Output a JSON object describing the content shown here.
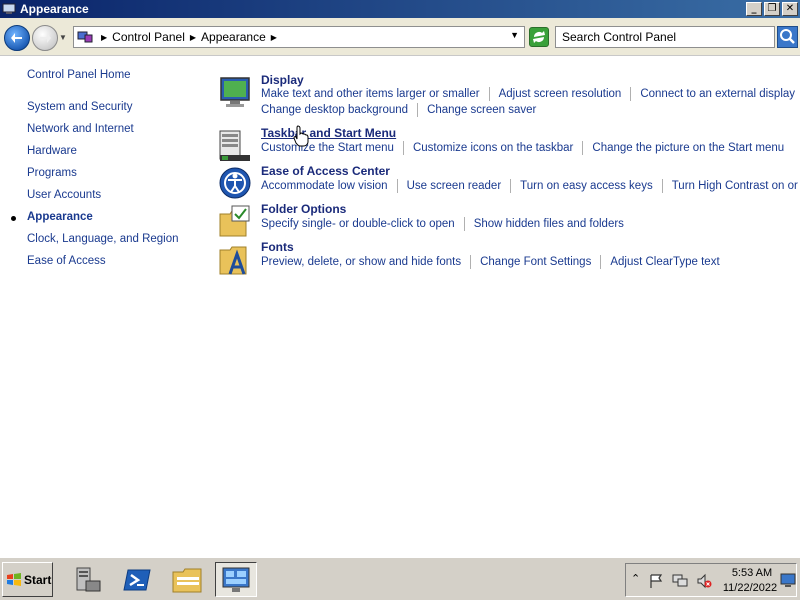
{
  "window": {
    "title": "Appearance"
  },
  "address": {
    "crumbs": [
      "Control Panel",
      "Appearance"
    ],
    "search_placeholder": "Search Control Panel"
  },
  "sidebar": {
    "items": [
      {
        "label": "Control Panel Home"
      },
      {
        "label": "System and Security"
      },
      {
        "label": "Network and Internet"
      },
      {
        "label": "Hardware"
      },
      {
        "label": "Programs"
      },
      {
        "label": "User Accounts"
      },
      {
        "label": "Appearance",
        "active": true
      },
      {
        "label": "Clock, Language, and Region"
      },
      {
        "label": "Ease of Access"
      }
    ]
  },
  "groups": [
    {
      "title": "Display",
      "icon": "display-icon",
      "links": [
        [
          "Make text and other items larger or smaller",
          "Adjust screen resolution",
          "Connect to an external display"
        ],
        [
          "Change desktop background",
          "Change screen saver"
        ]
      ]
    },
    {
      "title": "Taskbar and Start Menu",
      "icon": "taskbar-icon",
      "links": [
        [
          "Customize the Start menu",
          "Customize icons on the taskbar",
          "Change the picture on the Start menu"
        ]
      ]
    },
    {
      "title": "Ease of Access Center",
      "icon": "ease-of-access-icon",
      "links": [
        [
          "Accommodate low vision",
          "Use screen reader",
          "Turn on easy access keys",
          "Turn High Contrast on or off"
        ]
      ]
    },
    {
      "title": "Folder Options",
      "icon": "folder-options-icon",
      "links": [
        [
          "Specify single- or double-click to open",
          "Show hidden files and folders"
        ]
      ]
    },
    {
      "title": "Fonts",
      "icon": "fonts-icon",
      "links": [
        [
          "Preview, delete, or show and hide fonts",
          "Change Font Settings",
          "Adjust ClearType text"
        ]
      ]
    }
  ],
  "taskbar": {
    "start_label": "Start",
    "clock_time": "5:53 AM",
    "clock_date": "11/22/2022"
  },
  "colors": {
    "link": "#1a3a8f",
    "title_bar": "#0a246a",
    "taskbar": "#d4d0c8"
  }
}
